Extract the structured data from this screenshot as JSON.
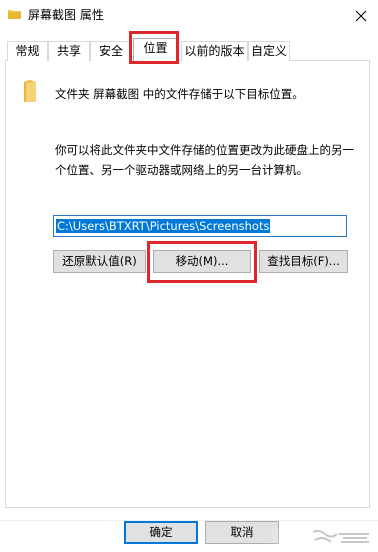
{
  "window": {
    "title": "屏幕截图 属性"
  },
  "tabs": [
    {
      "label": "常规"
    },
    {
      "label": "共享"
    },
    {
      "label": "安全"
    },
    {
      "label": "位置",
      "active": true
    },
    {
      "label": "以前的版本"
    },
    {
      "label": "自定义"
    }
  ],
  "location": {
    "heading": "文件夹 屏幕截图 中的文件存储于以下目标位置。",
    "description": "你可以将此文件夹中文件存储的位置更改为此硬盘上的另一个位置、另一个驱动器或网络上的另一台计算机。",
    "path_value": "C:\\Users\\BTXRT\\Pictures\\Screenshots",
    "restore_default_label": "还原默认值(R)",
    "move_label": "移动(M)...",
    "find_target_label": "查找目标(F)..."
  },
  "footer": {
    "ok_label": "确定",
    "cancel_label": "取消"
  },
  "colors": {
    "highlight": "#e0262d",
    "selection": "#0078d7",
    "folder": "#f2c94c"
  },
  "icons": {
    "title": "folder-icon",
    "close": "close-icon",
    "content": "folder-icon"
  }
}
